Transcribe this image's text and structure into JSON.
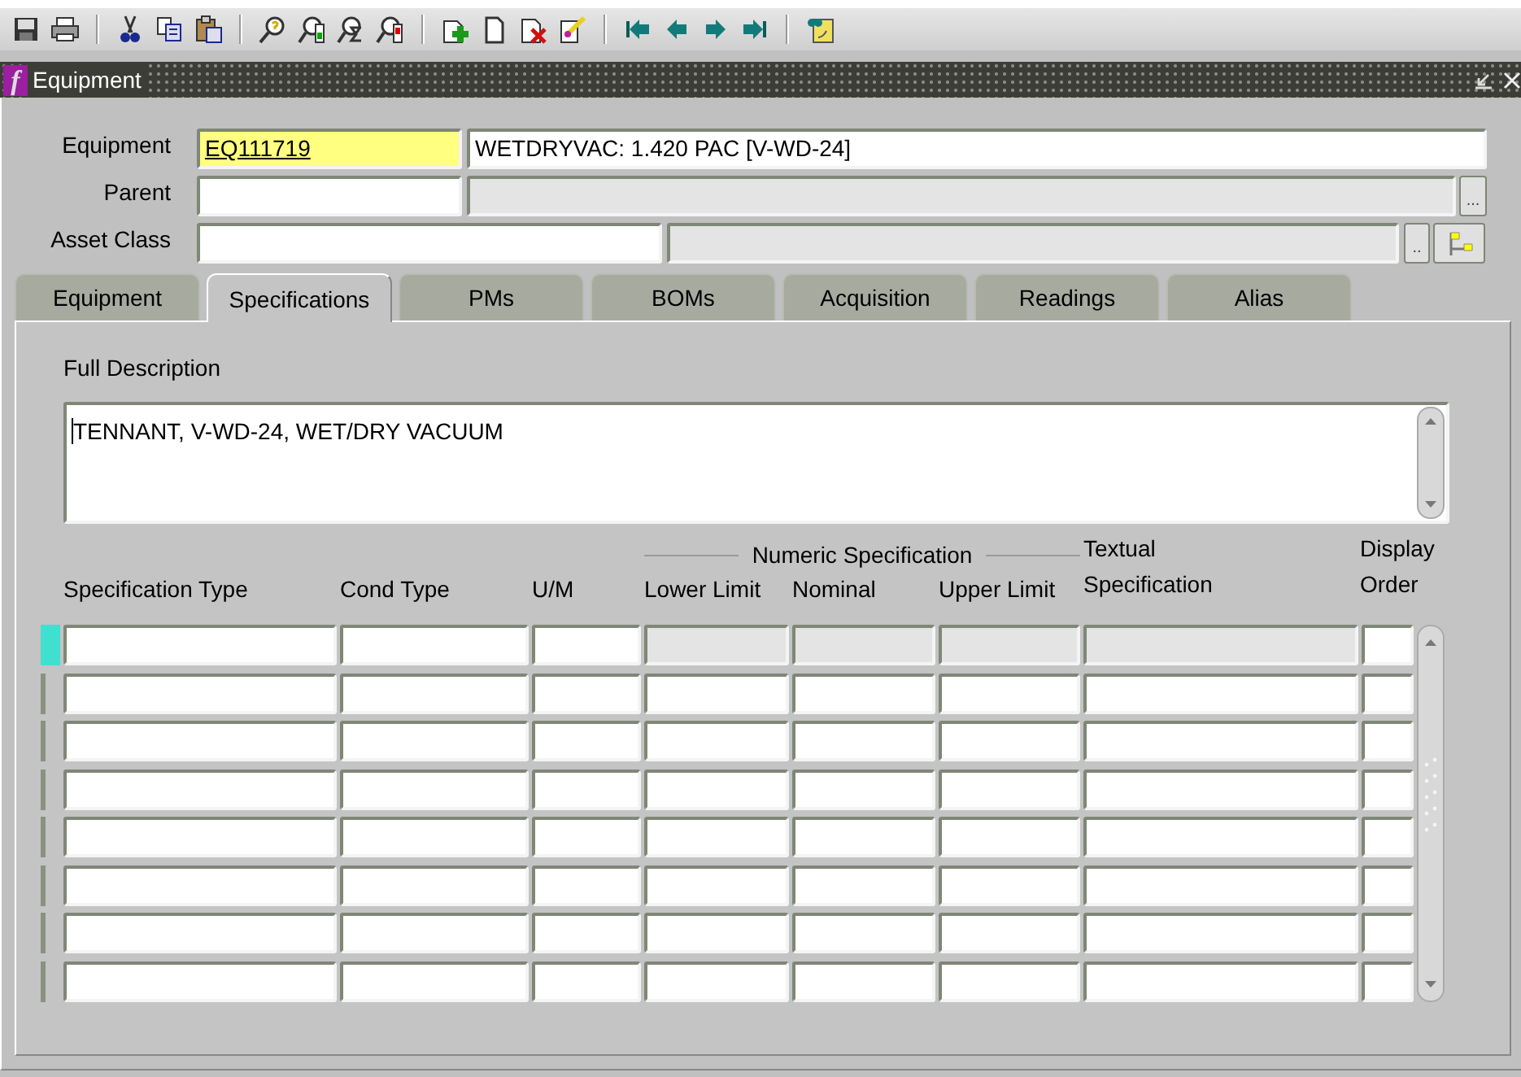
{
  "window": {
    "logo": "f",
    "title": "Equipment"
  },
  "header": {
    "equipment": {
      "label": "Equipment",
      "value": "EQ111719",
      "description": "WETDRYVAC: 1.420 PAC [V-WD-24]"
    },
    "parent": {
      "label": "Parent",
      "lov_button": "..."
    },
    "asset_class": {
      "label": "Asset Class",
      "lov_button": ".."
    }
  },
  "tabs": [
    {
      "label": "Equipment",
      "selected": false
    },
    {
      "label": "Specifications",
      "selected": true
    },
    {
      "label": "PMs",
      "selected": false
    },
    {
      "label": "BOMs",
      "selected": false
    },
    {
      "label": "Acquisition",
      "selected": false
    },
    {
      "label": "Readings",
      "selected": false
    },
    {
      "label": "Alias",
      "selected": false
    }
  ],
  "full_description": {
    "label": "Full Description",
    "value": "TENNANT, V-WD-24, WET/DRY VACUUM"
  },
  "table": {
    "group_header": "Numeric Specification",
    "columns": [
      "Specification Type",
      "Cond Type",
      "U/M",
      "Lower Limit",
      "Nominal",
      "Upper Limit",
      "Textual Specification",
      "Display Order"
    ],
    "rows": [
      {
        "current": true,
        "disabled": [
          false,
          false,
          false,
          true,
          true,
          true,
          true,
          false
        ]
      },
      {
        "current": false,
        "disabled": [
          false,
          false,
          false,
          false,
          false,
          false,
          false,
          false
        ]
      },
      {
        "current": false,
        "disabled": [
          false,
          false,
          false,
          false,
          false,
          false,
          false,
          false
        ]
      },
      {
        "current": false,
        "disabled": [
          false,
          false,
          false,
          false,
          false,
          false,
          false,
          false
        ]
      },
      {
        "current": false,
        "disabled": [
          false,
          false,
          false,
          false,
          false,
          false,
          false,
          false
        ]
      },
      {
        "current": false,
        "disabled": [
          false,
          false,
          false,
          false,
          false,
          false,
          false,
          false
        ]
      },
      {
        "current": false,
        "disabled": [
          false,
          false,
          false,
          false,
          false,
          false,
          false,
          false
        ]
      },
      {
        "current": false,
        "disabled": [
          false,
          false,
          false,
          false,
          false,
          false,
          false,
          false
        ]
      }
    ]
  }
}
